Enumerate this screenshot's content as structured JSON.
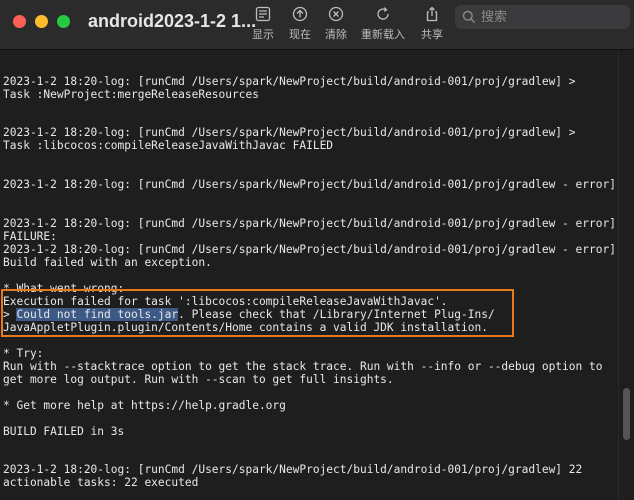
{
  "window": {
    "title": "android2023-1-2 1..."
  },
  "toolbar": {
    "show_label": "显示",
    "now_label": "现在",
    "clear_label": "清除",
    "reload_label": "重新载入",
    "share_label": "共享"
  },
  "search": {
    "placeholder": "搜索"
  },
  "log": {
    "lines": [
      "2023-1-2 18:20-log: [runCmd /Users/spark/NewProject/build/android-001/proj/gradlew] >",
      "Task :NewProject:mergeReleaseResources",
      "2023-1-2 18:20-log: [runCmd /Users/spark/NewProject/build/android-001/proj/gradlew] >",
      "Task :libcocos:compileReleaseJavaWithJavac FAILED",
      "2023-1-2 18:20-log: [runCmd /Users/spark/NewProject/build/android-001/proj/gradlew - error]",
      "2023-1-2 18:20-log: [runCmd /Users/spark/NewProject/build/android-001/proj/gradlew - error]",
      "FAILURE:",
      "2023-1-2 18:20-log: [runCmd /Users/spark/NewProject/build/android-001/proj/gradlew - error]",
      "Build failed with an exception.",
      "* What went wrong:",
      "Execution failed for task ':libcocos:compileReleaseJavaWithJavac'.",
      "> ",
      "Could not find tools.jar",
      ". Please check that /Library/Internet Plug-Ins/",
      "JavaAppletPlugin.plugin/Contents/Home contains a valid JDK installation.",
      "* Try:",
      "Run with --stacktrace option to get the stack trace. Run with --info or --debug option to",
      "get more log output. Run with --scan to get full insights.",
      "* Get more help at https://help.gradle.org",
      "BUILD FAILED in 3s",
      "2023-1-2 18:20-log: [runCmd /Users/spark/NewProject/build/android-001/proj/gradlew] 22",
      "actionable tasks: 22 executed"
    ]
  },
  "colors": {
    "background": "#1e1e1e",
    "text": "#e8e8e8",
    "highlight_box": "#e87a1e",
    "selection": "#3c5a85"
  }
}
